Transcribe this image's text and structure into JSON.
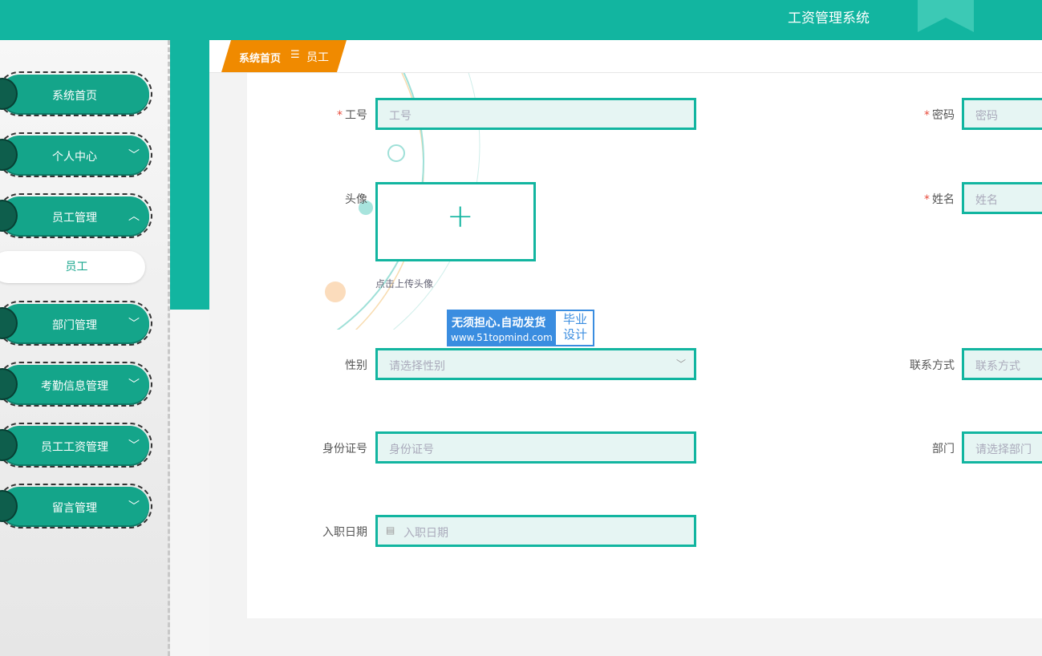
{
  "app": {
    "title": "工资管理系统"
  },
  "colors": {
    "accent": "#12b5a0",
    "breadcrumb": "#f08a00",
    "required": "#e84c3d"
  },
  "sidebar": {
    "items": [
      {
        "label": "系统首页",
        "chevron": ""
      },
      {
        "label": "个人中心",
        "chevron": "﹀"
      },
      {
        "label": "员工管理",
        "chevron": "︿"
      },
      {
        "label": "部门管理",
        "chevron": "﹀"
      },
      {
        "label": "考勤信息管理",
        "chevron": "﹀"
      },
      {
        "label": "员工工资管理",
        "chevron": "﹀"
      },
      {
        "label": "留言管理",
        "chevron": "﹀"
      }
    ],
    "submenu": {
      "label": "员工"
    }
  },
  "breadcrumb": {
    "home": "系统首页",
    "separator": "☰",
    "current": "员工"
  },
  "form": {
    "employee_no": {
      "label": "工号",
      "placeholder": "工号",
      "required": "*"
    },
    "password": {
      "label": "密码",
      "placeholder": "密码",
      "required": "*"
    },
    "avatar": {
      "label": "头像",
      "upload_icon": "+",
      "hint": "点击上传头像"
    },
    "name": {
      "label": "姓名",
      "placeholder": "姓名",
      "required": "*"
    },
    "gender": {
      "label": "性别",
      "placeholder": "请选择性别",
      "arrow": "﹀"
    },
    "contact": {
      "label": "联系方式",
      "placeholder": "联系方式"
    },
    "id_card": {
      "label": "身份证号",
      "placeholder": "身份证号"
    },
    "department": {
      "label": "部门",
      "placeholder": "请选择部门"
    },
    "hire_date": {
      "label": "入职日期",
      "placeholder": "入职日期",
      "icon": "calendar-icon"
    }
  },
  "watermark": {
    "line1": "无须担心.自动发货",
    "line2": "www.51topmind.com",
    "right": "毕业设计"
  }
}
